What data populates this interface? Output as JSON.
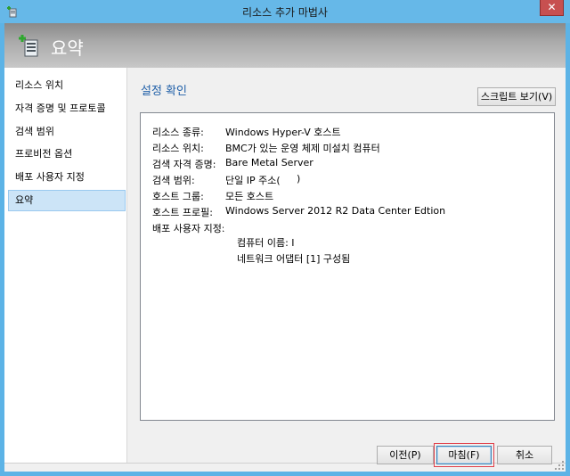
{
  "window": {
    "title": "리소스 추가 마법사",
    "close_symbol": "✕"
  },
  "banner": {
    "title": "요약",
    "icon": "server-add-icon"
  },
  "nav": {
    "items": [
      {
        "label": "리소스 위치"
      },
      {
        "label": "자격 증명 및 프로토콜"
      },
      {
        "label": "검색 범위"
      },
      {
        "label": "프로비전 옵션"
      },
      {
        "label": "배포 사용자 지정"
      },
      {
        "label": "요약",
        "selected": true
      }
    ]
  },
  "content": {
    "section_title": "설정 확인",
    "script_button": "스크립트 보기(V)",
    "rows": [
      {
        "label": "리소스 종류:",
        "value": "Windows Hyper-V 호스트"
      },
      {
        "label": "리소스 위치:",
        "value": "BMC가 있는 운영 체제 미설치 컴퓨터"
      },
      {
        "label": "검색 자격 증명:",
        "value": "Bare Metal Server"
      },
      {
        "label": "검색 범위:",
        "value": "단일 IP 주소("
      },
      {
        "label": "호스트 그룹:",
        "value": "모든 호스트"
      },
      {
        "label": "호스트 프로필:",
        "value": "Windows Server 2012 R2 Data Center Edtion"
      },
      {
        "label": "배포 사용자 지정:",
        "value": ""
      }
    ],
    "scope_close": ")",
    "computer_name": "컴퓨터 이름: I",
    "network_adapter": "네트워크 어댑터 [1] 구성됨"
  },
  "footer": {
    "prev_button": "이전(P)",
    "finish_button": "마침(F)",
    "cancel_button": "취소"
  },
  "colors": {
    "title_bar": "#66b8e8",
    "close": "#c75050",
    "selected_nav": "#cce4f7",
    "section_title": "#1f5fa8",
    "focus_highlight": "#e0404a"
  }
}
